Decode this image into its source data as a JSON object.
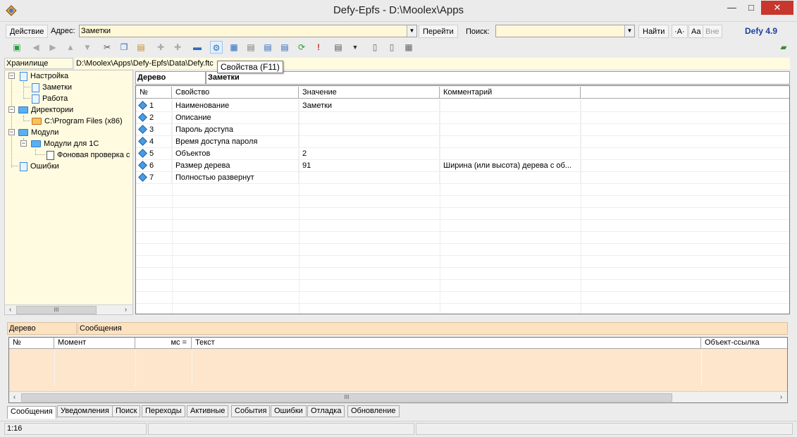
{
  "window": {
    "title": "Defy-Epfs - D:\\Moolex\\Apps",
    "min": "—",
    "max": "□",
    "close": "✕"
  },
  "addressbar": {
    "action_label": "Действие",
    "address_label": "Адрес:",
    "address_value": "Заметки",
    "go_label": "Перейти",
    "search_label": "Поиск:",
    "search_value": "",
    "find_label": "Найти",
    "case_a_label": "·A·",
    "case_aa_label": "Aa",
    "case_ne_label": "Вне",
    "version": "Defy 4.9"
  },
  "toolbar": {
    "icons": [
      "new-icon",
      "back-icon",
      "forward-icon",
      "up-icon",
      "down-icon",
      "cut-icon",
      "copy-icon",
      "paste-icon",
      "add-icon",
      "add-child-icon",
      "remove-icon",
      "properties-icon",
      "table-icon",
      "doc-icon",
      "doc2-icon",
      "doc3-icon",
      "refresh-icon",
      "alert-icon",
      "view-icon",
      "dropdown-icon",
      "split-v-icon",
      "split-h-icon",
      "grid-icon",
      "book-icon"
    ]
  },
  "storage": {
    "label": "Хранилище",
    "path": "D:\\Moolex\\Apps\\Defy-Epfs\\Data\\Defy.ftc"
  },
  "tooltip": "Свойства (F11)",
  "tree": {
    "nodes": [
      {
        "label": "Настройка"
      },
      {
        "label": "Заметки"
      },
      {
        "label": "Работа"
      },
      {
        "label": "Директории"
      },
      {
        "label": "C:\\Program Files (x86)"
      },
      {
        "label": "Модули"
      },
      {
        "label": "Модули для 1С"
      },
      {
        "label": "Фоновая проверка с"
      },
      {
        "label": "Ошибки"
      }
    ],
    "scroll_thumb": "III"
  },
  "panel_tabs": {
    "tree": "Дерево",
    "notes": "Заметки"
  },
  "grid": {
    "headers": [
      "№",
      "Свойство",
      "Значение",
      "Комментарий"
    ],
    "rows": [
      {
        "num": "1",
        "prop": "Наименование",
        "value": "Заметки",
        "comment": ""
      },
      {
        "num": "2",
        "prop": "Описание",
        "value": "",
        "comment": ""
      },
      {
        "num": "3",
        "prop": "Пароль доступа",
        "value": "",
        "comment": ""
      },
      {
        "num": "4",
        "prop": "Время доступа пароля",
        "value": "",
        "comment": ""
      },
      {
        "num": "5",
        "prop": "Объектов",
        "value": "2",
        "comment": ""
      },
      {
        "num": "6",
        "prop": "Размер дерева",
        "value": "91",
        "comment": "Ширина (или высота) дерева с об..."
      },
      {
        "num": "7",
        "prop": "Полностью развернут",
        "value": "",
        "comment": ""
      }
    ]
  },
  "lower": {
    "tab_tree": "Дерево",
    "tab_messages": "Сообщения",
    "headers": [
      "№",
      "Момент",
      "мс =",
      "Текст",
      "Объект-ссылка"
    ],
    "scroll_thumb": "III"
  },
  "bottom_tabs": [
    "Сообщения",
    "Уведомления",
    "Поиск",
    "Переходы",
    "Активные",
    "События",
    "Ошибки",
    "Отладка",
    "Обновление"
  ],
  "status": {
    "position": "1:16",
    "panel2": "",
    "panel3": ""
  }
}
